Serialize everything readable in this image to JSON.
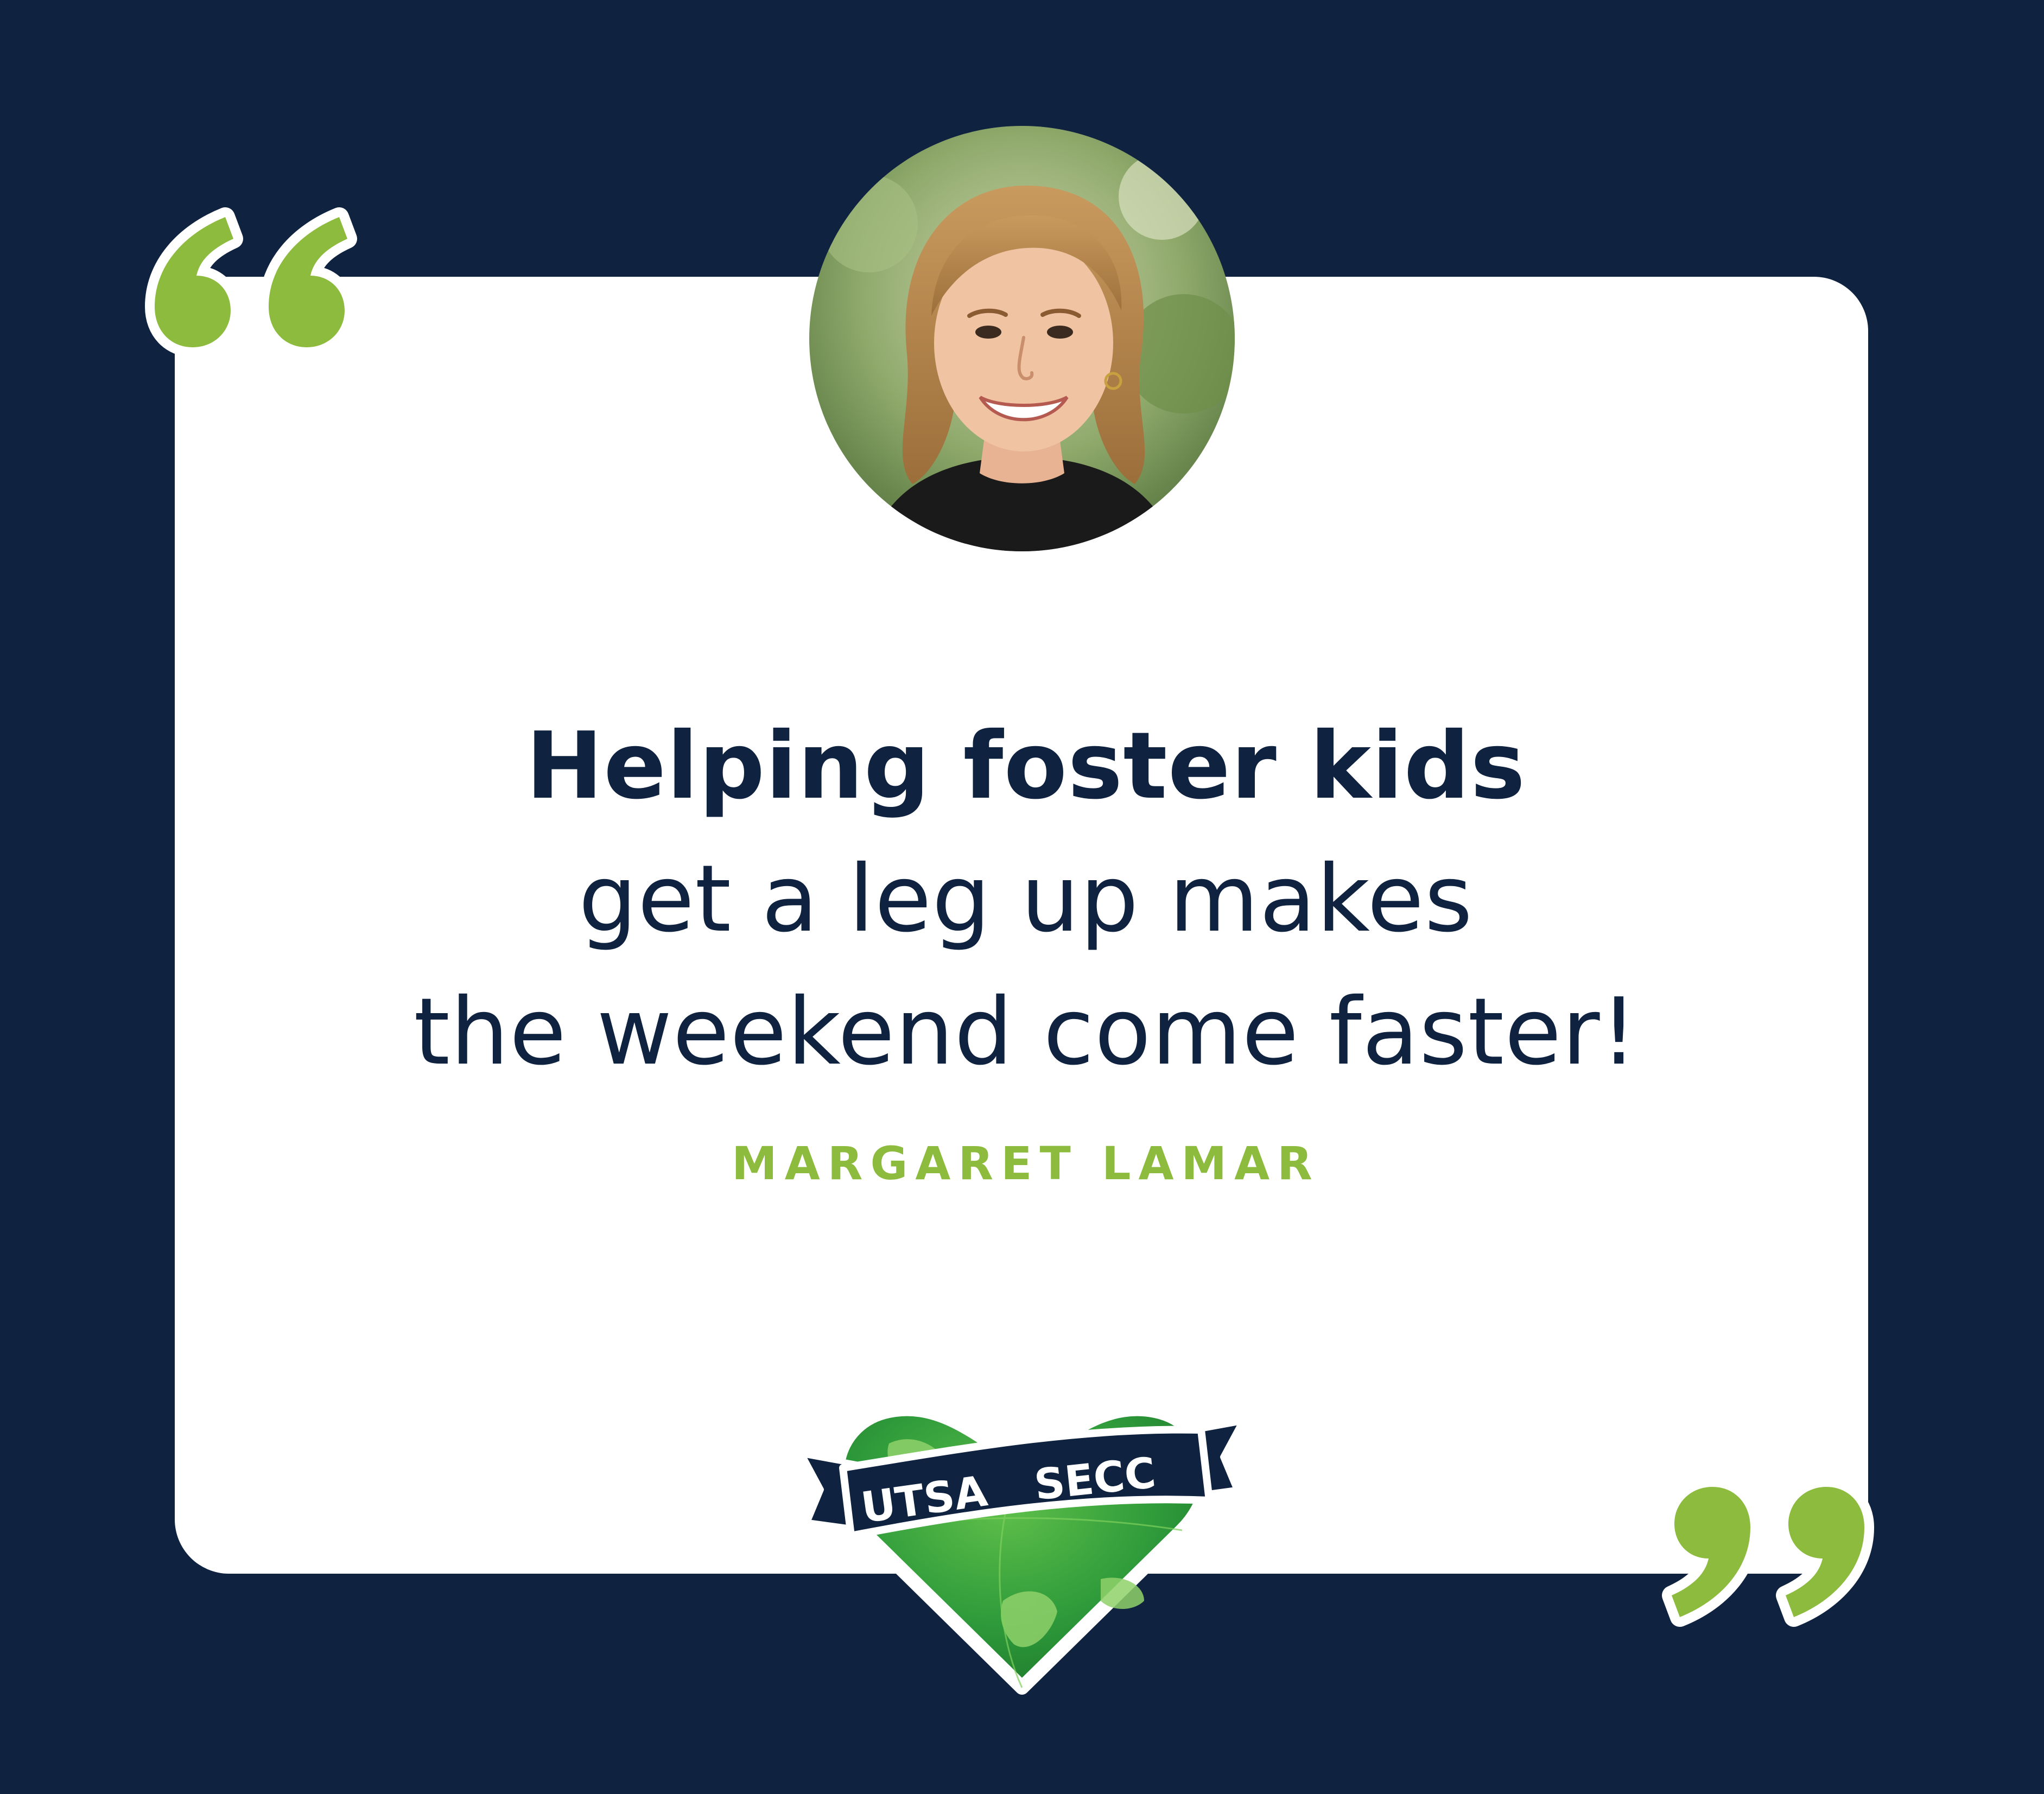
{
  "quote": {
    "lines": [
      "Helping foster kids",
      "get a leg up makes",
      "the weekend come faster!"
    ]
  },
  "author": "MARGARET LAMAR",
  "logo": {
    "left_text": "UTSA",
    "right_text": "SECC"
  },
  "icons": {
    "open_quote": "open-quote-icon",
    "close_quote": "close-quote-icon",
    "heart_globe": "heart-globe-icon"
  },
  "colors": {
    "background": "#0f2240",
    "card": "#ffffff",
    "accent_green": "#8dbb3e",
    "text_navy": "#0f2240"
  }
}
